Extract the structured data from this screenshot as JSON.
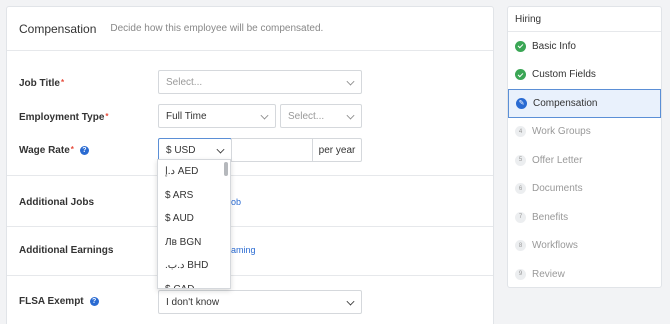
{
  "header": {
    "title": "Compensation",
    "subtitle": "Decide how this employee will be compensated."
  },
  "form": {
    "job_title": {
      "label": "Job Title",
      "placeholder": "Select..."
    },
    "employment_type": {
      "label": "Employment Type",
      "value": "Full Time",
      "second_placeholder": "Select..."
    },
    "wage_rate": {
      "label": "Wage Rate",
      "currency": "$ USD",
      "period": "per year"
    },
    "additional_jobs": {
      "label": "Additional Jobs",
      "link_fragment": "ob"
    },
    "additional_earnings": {
      "label": "Additional Earnings",
      "link_fragment": "aming"
    },
    "flsa_exempt": {
      "label": "FLSA Exempt",
      "value": "I don't know"
    }
  },
  "currency_dropdown": {
    "options": [
      "د.إ AED",
      "$ ARS",
      "$ AUD",
      "Лв BGN",
      ".د.ب BHD",
      "$ CAD"
    ]
  },
  "sidebar": {
    "title": "Hiring",
    "steps": [
      {
        "label": "Basic Info",
        "status": "done"
      },
      {
        "label": "Custom Fields",
        "status": "done"
      },
      {
        "label": "Compensation",
        "status": "active"
      },
      {
        "label": "Work Groups",
        "status": "pending",
        "number": "4"
      },
      {
        "label": "Offer Letter",
        "status": "pending",
        "number": "5"
      },
      {
        "label": "Documents",
        "status": "pending",
        "number": "6"
      },
      {
        "label": "Benefits",
        "status": "pending",
        "number": "7"
      },
      {
        "label": "Workflows",
        "status": "pending",
        "number": "8"
      },
      {
        "label": "Review",
        "status": "pending",
        "number": "9"
      }
    ]
  },
  "colors": {
    "accent": "#2a6bd2",
    "success": "#3aa655",
    "required": "#e74c3c"
  }
}
